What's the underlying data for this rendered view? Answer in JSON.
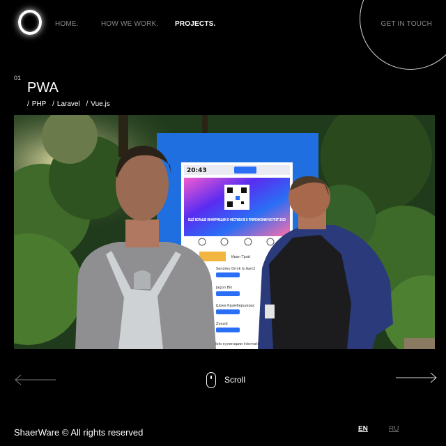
{
  "brand": {
    "copyright": "ShaerWare © All rights reserved"
  },
  "nav": {
    "items": [
      {
        "label": "HOME."
      },
      {
        "label": "HOW WE WORK."
      },
      {
        "label": "PROJECTS."
      }
    ],
    "cta": "GET IN TOUCH"
  },
  "project": {
    "number": "01",
    "title": "PWA",
    "separator": "/",
    "tags": [
      "PHP",
      "Laravel",
      "Vue.js"
    ]
  },
  "photo_screen": {
    "time": "20:43",
    "heading": "ЕЩЁ БОЛЬШЕ ИНФОРМАЦИИ О ФЕСТИВАЛЕ В ПРИЛОЖЕНИИ VK FEST 2023",
    "list_items": [
      "Иван Трой",
      "Sendrey Drink & Aart2",
      "Jagon Blk",
      "Шоке Крамбершерас",
      "Zvezdi"
    ],
    "bottom_text": "Idolo кулинарии international"
  },
  "scroll": {
    "label": "Scroll"
  },
  "languages": {
    "en": "EN",
    "ru": "RU"
  },
  "colors": {
    "background": "#000000",
    "text": "#ffffff",
    "muted": "#8a8a8a",
    "kiosk": "#1f6fe0"
  }
}
